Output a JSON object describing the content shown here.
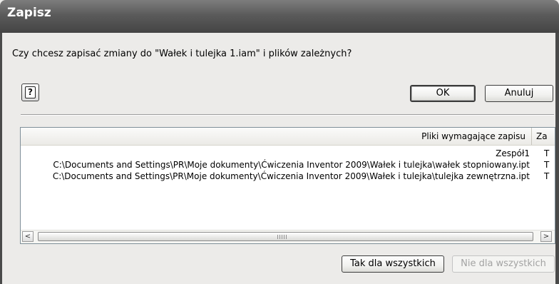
{
  "window": {
    "title": "Zapisz"
  },
  "dialog": {
    "question": "Czy chcesz zapisać zmiany do \"Wałek i tulejka 1.iam\" i plików zależnych?",
    "help_icon": "question-mark-icon",
    "ok_label": "OK",
    "cancel_label": "Anuluj",
    "yes_all_label": "Tak dla wszystkich",
    "no_all_label": "Nie dla wszystkich"
  },
  "list": {
    "columns": [
      "Pliki wymagające zapisu",
      "Za"
    ],
    "rows": [
      {
        "path": "Zespół1",
        "type": "T"
      },
      {
        "path": "C:\\Documents and Settings\\PR\\Moje dokumenty\\Ćwiczenia Inventor 2009\\Wałek i tulejka\\wałek stopniowany.ipt",
        "type": "T"
      },
      {
        "path": "C:\\Documents and Settings\\PR\\Moje dokumenty\\Ćwiczenia Inventor 2009\\Wałek i tulejka\\tulejka zewnętrzna.ipt",
        "type": "T"
      }
    ],
    "scroll_left": "<",
    "scroll_right": ">"
  }
}
